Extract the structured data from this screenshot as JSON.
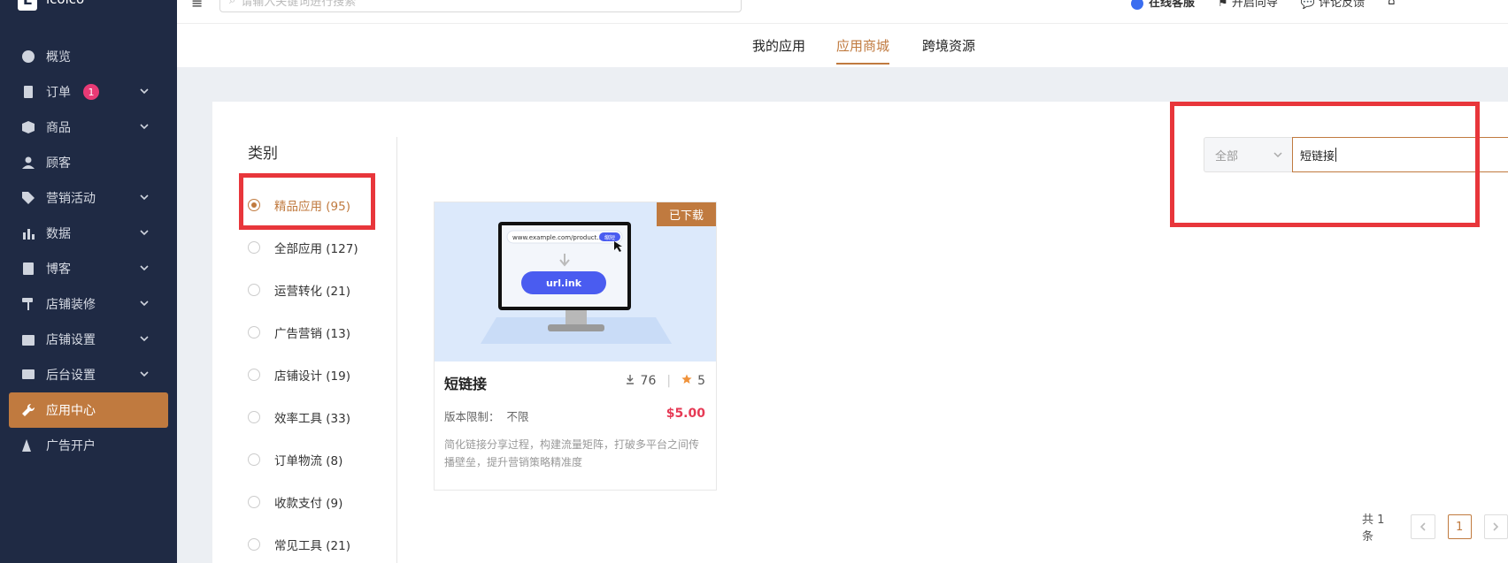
{
  "brand": {
    "logo_letter": "L",
    "name": "lcolco"
  },
  "topbar": {
    "search_placeholder": "请输入关键词进行搜索",
    "online_service": "在线客服",
    "guide": "开启向导",
    "feedback": "评论反馈"
  },
  "sidebar": {
    "items": [
      {
        "label": "概览",
        "icon": "dashboard-icon",
        "expandable": false
      },
      {
        "label": "订单",
        "icon": "order-icon",
        "expandable": true,
        "badge": "1"
      },
      {
        "label": "商品",
        "icon": "goods-icon",
        "expandable": true
      },
      {
        "label": "顾客",
        "icon": "user-icon",
        "expandable": false
      },
      {
        "label": "营销活动",
        "icon": "tag-icon",
        "expandable": true
      },
      {
        "label": "数据",
        "icon": "chart-icon",
        "expandable": true
      },
      {
        "label": "博客",
        "icon": "blog-icon",
        "expandable": true
      },
      {
        "label": "店铺装修",
        "icon": "paint-roller-icon",
        "expandable": true
      },
      {
        "label": "店铺设置",
        "icon": "store-icon",
        "expandable": true
      },
      {
        "label": "后台设置",
        "icon": "settings-panel-icon",
        "expandable": true
      },
      {
        "label": "应用中心",
        "icon": "wrench-icon",
        "expandable": false,
        "active": true
      },
      {
        "label": "广告开户",
        "icon": "ads-icon",
        "expandable": false
      }
    ]
  },
  "tabs": [
    {
      "label": "我的应用",
      "active": false
    },
    {
      "label": "应用商城",
      "active": true
    },
    {
      "label": "跨境资源",
      "active": false
    }
  ],
  "categories": {
    "title": "类别",
    "items": [
      {
        "label": "精品应用 (95)",
        "selected": true
      },
      {
        "label": "全部应用 (127)",
        "selected": false
      },
      {
        "label": "运营转化 (21)",
        "selected": false
      },
      {
        "label": "广告营销 (13)",
        "selected": false
      },
      {
        "label": "店铺设计 (19)",
        "selected": false
      },
      {
        "label": "效率工具 (33)",
        "selected": false
      },
      {
        "label": "订单物流 (8)",
        "selected": false
      },
      {
        "label": "收款支付 (9)",
        "selected": false
      },
      {
        "label": "常见工具 (21)",
        "selected": false
      }
    ]
  },
  "filter": {
    "scope": "全部",
    "keyword": "短链接"
  },
  "card": {
    "ribbon": "已下载",
    "name": "短链接",
    "downloads": "76",
    "rating": "5",
    "limit_label": "版本限制：",
    "limit_value": "不限",
    "price": "$5.00",
    "description": "简化链接分享过程，构建流量矩阵，打破多平台之间传播壁垒，提升营销策略精准度",
    "image": {
      "url_text": "www.example.com/product...",
      "short_btn": "缩短",
      "result": "url.ink"
    }
  },
  "pagination": {
    "total": "共 1 条",
    "current": "1"
  },
  "colors": {
    "sidebar_bg": "#1f2a44",
    "accent": "#c07a3f",
    "price": "#e63a55",
    "highlight": "#e8363b",
    "badge": "#e83a75"
  }
}
